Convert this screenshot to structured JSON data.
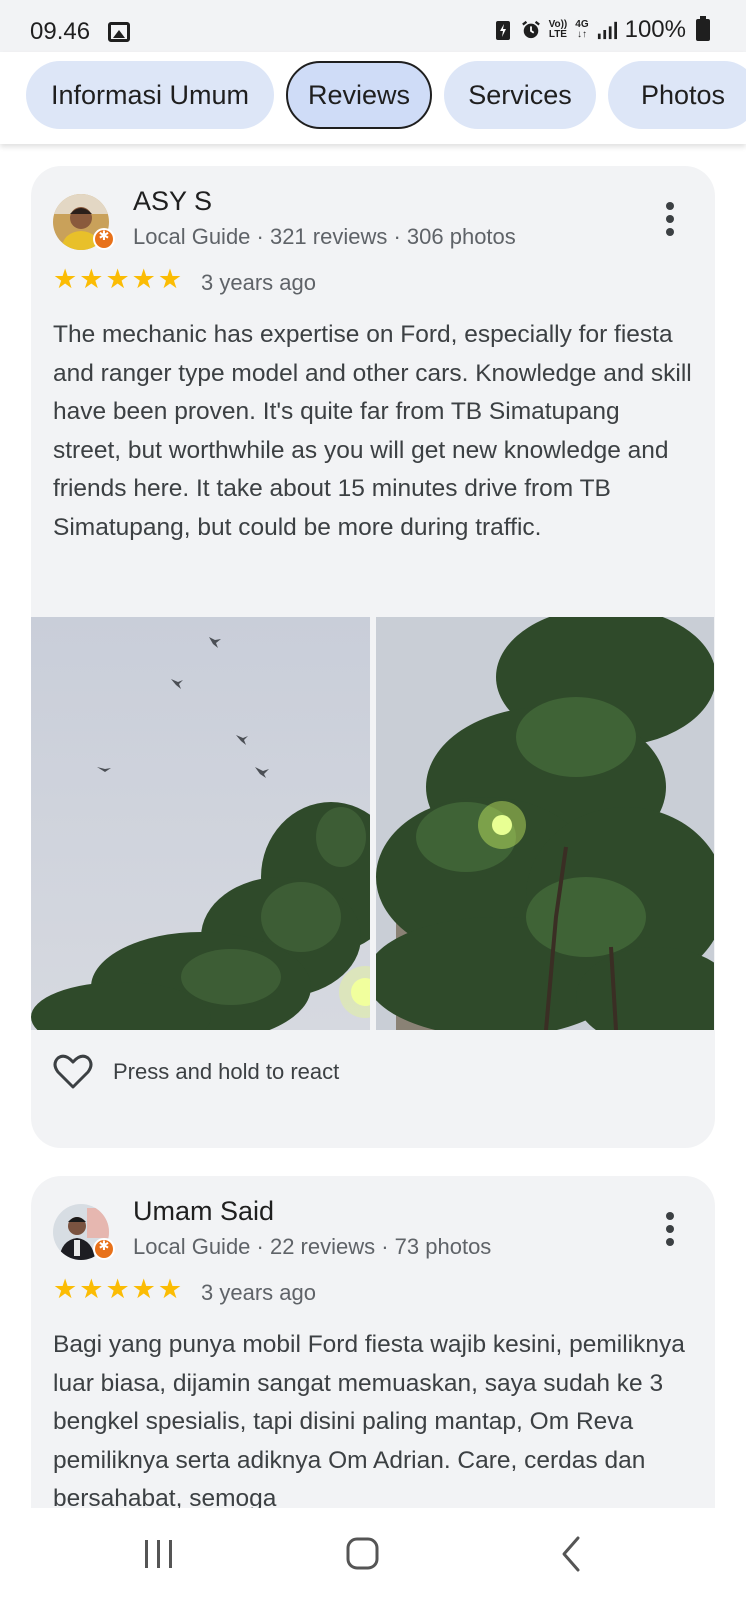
{
  "status_bar": {
    "time": "09.46",
    "volte_top": "Vo))",
    "volte_bottom": "LTE",
    "network": "4G",
    "battery": "100%",
    "icons": [
      "gallery-icon",
      "battery-saver-icon",
      "alarm-icon",
      "volte-icon",
      "network-4g-icon",
      "signal-icon",
      "battery-icon"
    ]
  },
  "tabs": [
    {
      "label": "Informasi Umum",
      "active": false
    },
    {
      "label": "Reviews",
      "active": true
    },
    {
      "label": "Services",
      "active": false
    },
    {
      "label": "Photos",
      "active": false
    }
  ],
  "reviews": [
    {
      "name": "ASY S",
      "meta": "Local Guide · 321 reviews · 306 photos",
      "rating": 5,
      "time": "3 years ago",
      "text": "The mechanic has expertise on Ford, especially for fiesta and ranger type model and other cars. Knowledge and skill have been proven. It's quite far from TB Simatupang street, but worthwhile as you will get new knowledge and friends here. It take about 15 minutes drive from TB Simatupang, but could be more during traffic.",
      "photo_count": 2,
      "react_label": "Press and hold to react"
    },
    {
      "name": "Umam Said",
      "meta": "Local Guide · 22 reviews · 73 photos",
      "rating": 5,
      "time": "3 years ago",
      "text": "Bagi yang punya mobil Ford fiesta wajib kesini, pemiliknya luar biasa, dijamin sangat memuaskan, saya sudah ke 3 bengkel spesialis, tapi disini paling mantap, Om Reva pemiliknya serta adiknya Om Adrian. Care, cerdas dan bersahabat, semoga"
    }
  ],
  "colors": {
    "star": "#fbbc04",
    "card_bg": "#f2f3f5",
    "tab_bg": "#dde6f7",
    "tab_active_bg": "#cfdcf7",
    "local_guide_badge": "#e8711a"
  },
  "nav": [
    "recent-apps-icon",
    "home-icon",
    "back-icon"
  ]
}
